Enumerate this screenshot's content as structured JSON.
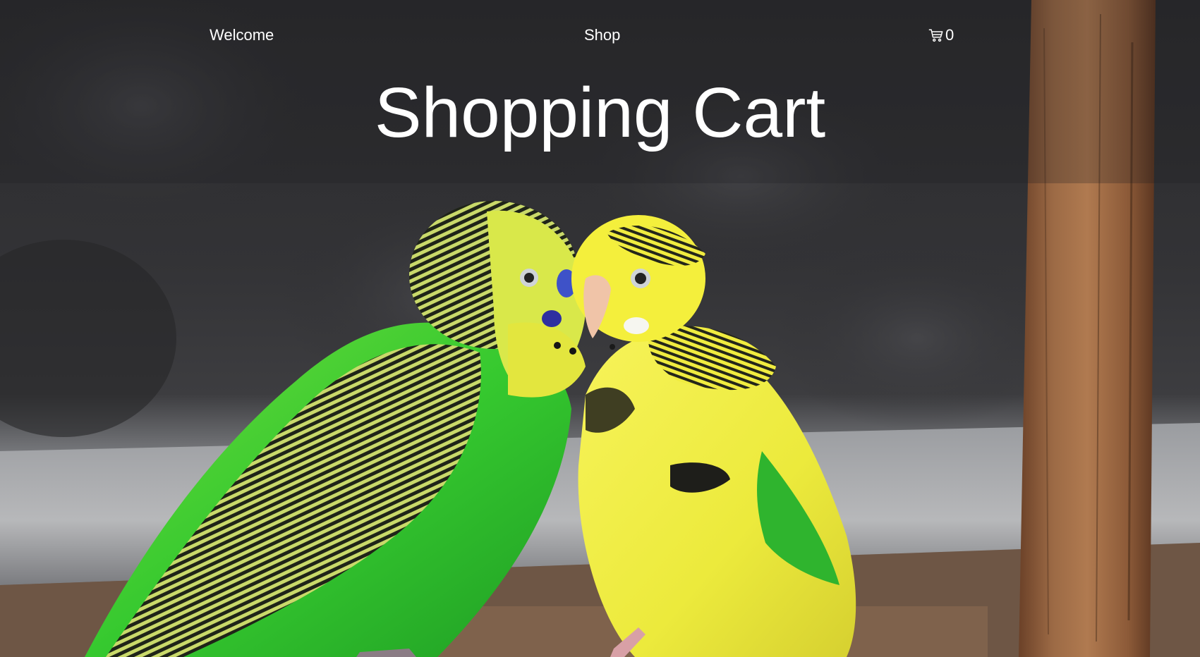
{
  "nav": {
    "welcome_label": "Welcome",
    "shop_label": "Shop",
    "cart_count": "0"
  },
  "hero": {
    "title": "Shopping Cart"
  },
  "colors": {
    "text": "#ffffff",
    "background_dark": "#2e2e31",
    "green_bird": "#3fd63a",
    "yellow_bird": "#f2ee3a",
    "perch_wood": "#8a5a3a"
  },
  "icons": {
    "cart": "shopping-cart-icon"
  }
}
